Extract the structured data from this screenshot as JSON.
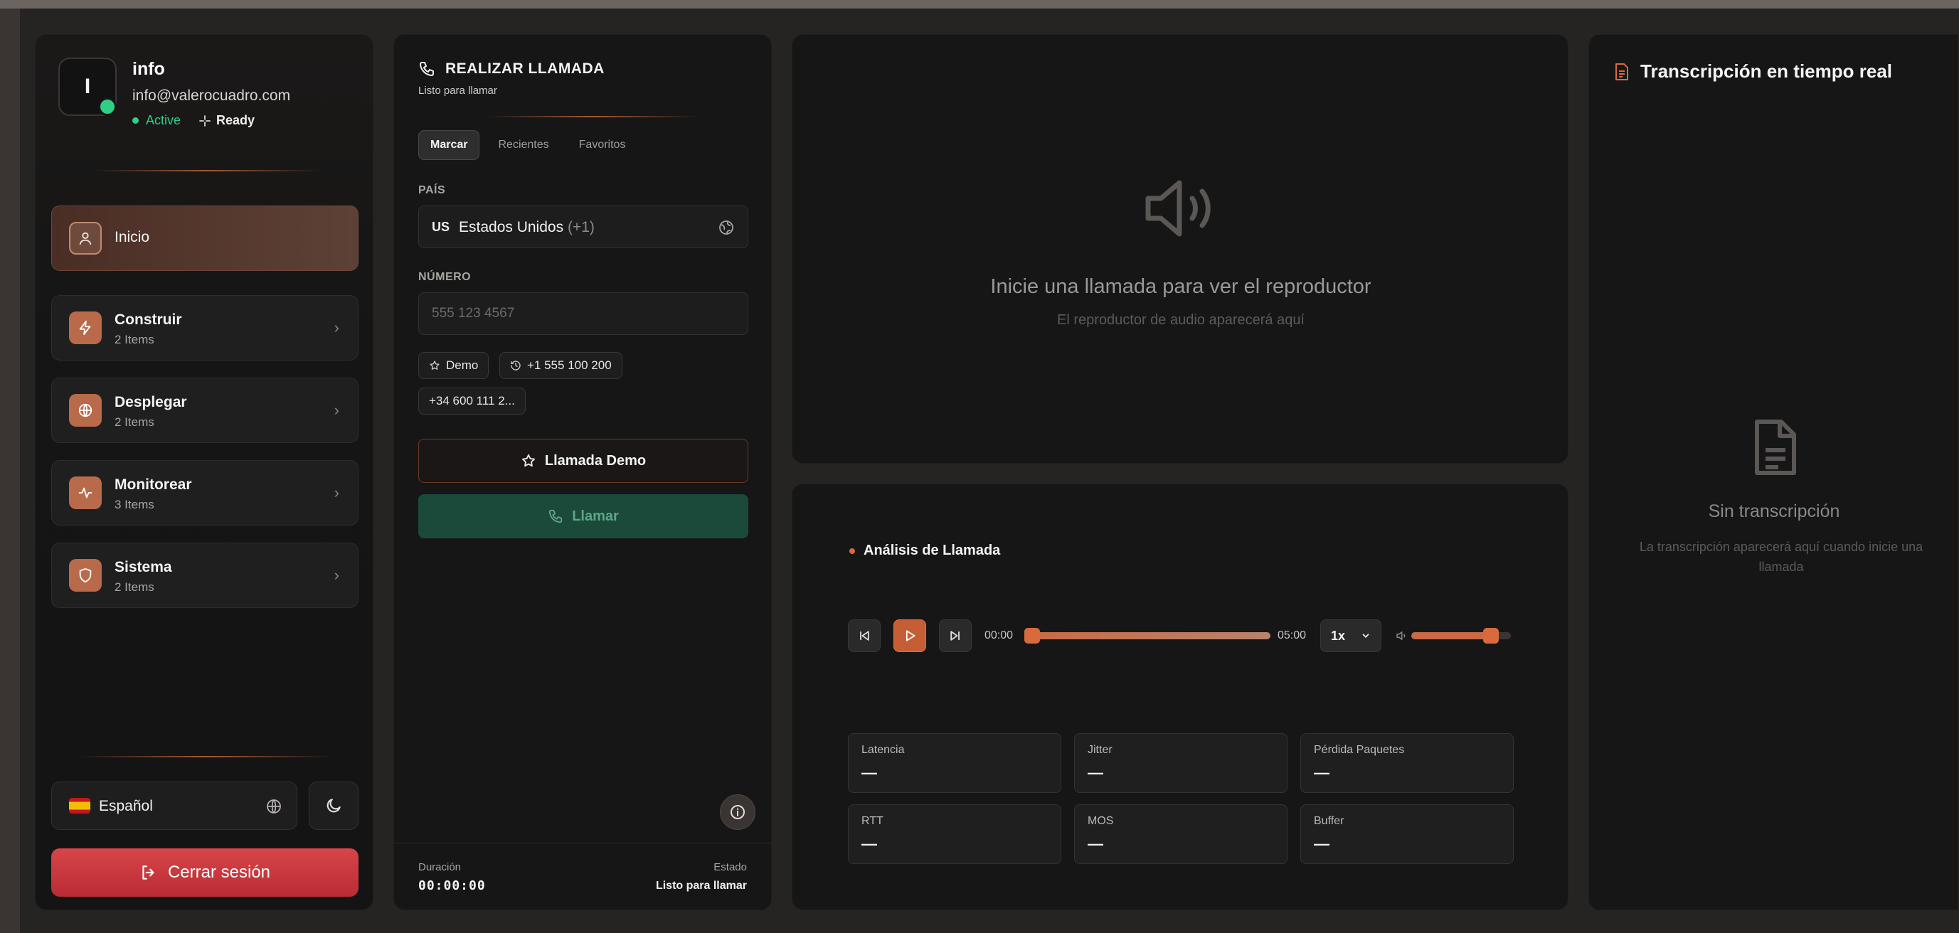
{
  "sidebar": {
    "avatar_initial": "I",
    "user_name": "info",
    "user_email": "info@valerocuadro.com",
    "status_active": "Active",
    "status_ready": "Ready",
    "nav": [
      {
        "label": "Inicio",
        "count": ""
      },
      {
        "label": "Construir",
        "count": "2 Items"
      },
      {
        "label": "Desplegar",
        "count": "2 Items"
      },
      {
        "label": "Monitorear",
        "count": "3 Items"
      },
      {
        "label": "Sistema",
        "count": "2 Items"
      }
    ],
    "language": "Español",
    "logout_label": "Cerrar sesión"
  },
  "call_panel": {
    "title": "REALIZAR LLAMADA",
    "subtitle": "Listo para llamar",
    "tabs": [
      "Marcar",
      "Recientes",
      "Favoritos"
    ],
    "country_label": "PAÍS",
    "country_code": "US",
    "country_name": "Estados Unidos",
    "country_prefix": "(+1)",
    "number_label": "NÚMERO",
    "number_placeholder": "555 123 4567",
    "chips": [
      "Demo",
      "+1 555 100 200",
      "+34 600 111 2..."
    ],
    "demo_call_label": "Llamada Demo",
    "call_label": "Llamar",
    "duration_label": "Duración",
    "duration_value": "00:00:00",
    "status_label": "Estado",
    "status_value": "Listo para llamar"
  },
  "player": {
    "title": "Inicie una llamada para ver el reproductor",
    "subtitle": "El reproductor de audio aparecerá aquí"
  },
  "analysis": {
    "title": "Análisis de Llamada",
    "time_current": "00:00",
    "time_total": "05:00",
    "progress": 0,
    "speed": "1x",
    "volume": 0.8,
    "metrics": [
      {
        "label": "Latencia",
        "value": "—"
      },
      {
        "label": "Jitter",
        "value": "—"
      },
      {
        "label": "Pérdida Paquetes",
        "value": "—"
      },
      {
        "label": "RTT",
        "value": "—"
      },
      {
        "label": "MOS",
        "value": "—"
      },
      {
        "label": "Buffer",
        "value": "—"
      }
    ]
  },
  "transcript": {
    "title": "Transcripción en tiempo real",
    "empty_title": "Sin transcripción",
    "empty_sub": "La transcripción aparecerá aquí cuando inicie una llamada"
  },
  "colors": {
    "accent": "#c55e34",
    "success": "#2fcf85",
    "danger": "#c9363c",
    "call_green": "#1b4a3a"
  }
}
